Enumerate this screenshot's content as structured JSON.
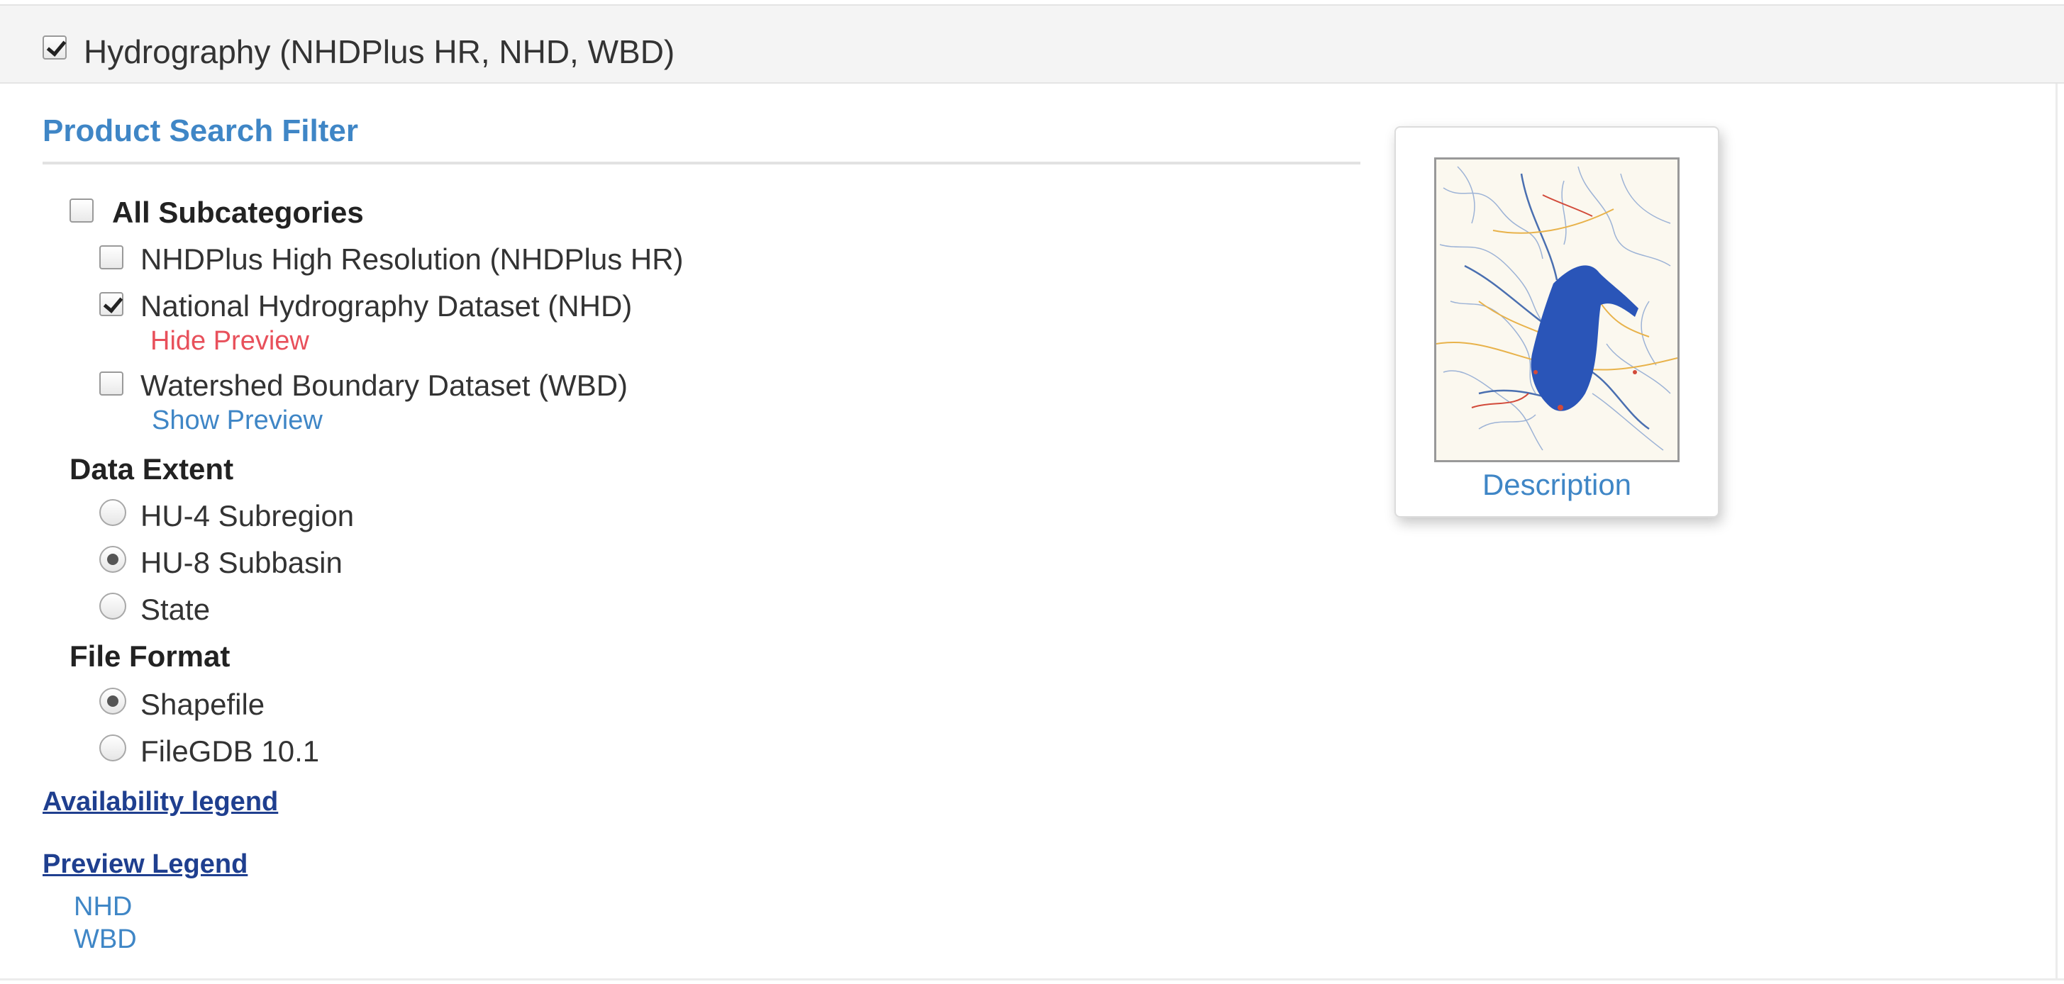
{
  "header": {
    "title": "Hydrography (NHDPlus HR, NHD, WBD)",
    "checked": true
  },
  "filter": {
    "title": "Product Search Filter",
    "all_subcategories": {
      "label": "All Subcategories",
      "checked": false
    },
    "subcategories": [
      {
        "label": "NHDPlus High Resolution (NHDPlus HR)",
        "checked": false
      },
      {
        "label": "National Hydrography Dataset (NHD)",
        "checked": true,
        "preview_link": "Hide Preview",
        "preview_color": "#e8505b"
      },
      {
        "label": "Watershed Boundary Dataset (WBD)",
        "checked": false,
        "preview_link": "Show Preview",
        "preview_color": "#3f86c6"
      }
    ],
    "data_extent": {
      "heading": "Data Extent",
      "options": [
        {
          "label": "HU-4 Subregion",
          "selected": false
        },
        {
          "label": "HU-8 Subbasin",
          "selected": true
        },
        {
          "label": "State",
          "selected": false
        }
      ]
    },
    "file_format": {
      "heading": "File Format",
      "options": [
        {
          "label": "Shapefile",
          "selected": true
        },
        {
          "label": "FileGDB 10.1",
          "selected": false
        }
      ]
    },
    "availability_legend": "Availability legend",
    "preview_legend": {
      "title": "Preview Legend",
      "items": [
        "NHD",
        "WBD"
      ]
    }
  },
  "preview": {
    "description_link": "Description",
    "thumbnail": "hydrography-map-thumbnail"
  },
  "colors": {
    "accent": "#3f86c6",
    "link_red": "#e8505b",
    "legend_link": "#1f3f8f",
    "water": "#2a55b8"
  }
}
